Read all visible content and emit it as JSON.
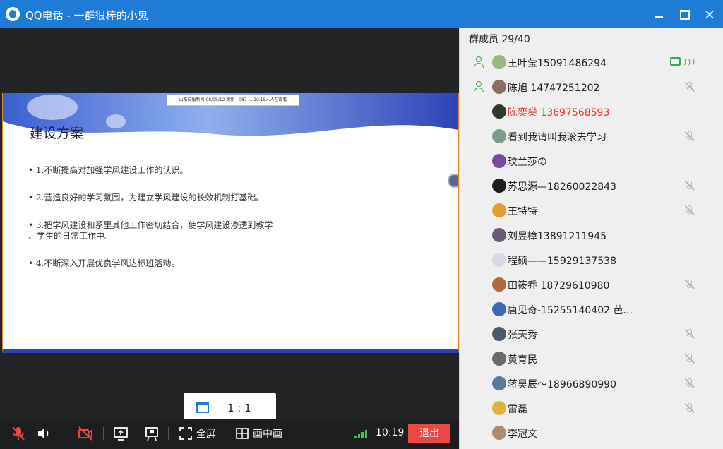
{
  "window": {
    "title": "QQ电话 - 一群很棒的小鬼",
    "min_glyph": "",
    "max_glyph": "",
    "close_glyph": "×"
  },
  "slide": {
    "header_text": "山东日报新闻    08/08/12    更新 : 087 ...  20:15人人在观看",
    "title": "建设方案",
    "bullets": [
      "1.不断提高对加强学风建设工作的认识。",
      "2.营造良好的学习氛围，为建立学风建设的长效机制打基础。",
      "3.把学风建设和系里其他工作密切结合，使学风建设渗透到教学\n、学生的日常工作中。",
      "4.不断深入开展优良学风达标班活动。"
    ]
  },
  "ratio": {
    "label": "1 : 1"
  },
  "controls": {
    "fullscreen": "全屏",
    "pip": "画中画",
    "time": "10:19",
    "exit": "退出"
  },
  "members": {
    "header": "群成员 29/40",
    "list": [
      {
        "name": "王叶莹15091486294",
        "host": true,
        "status": "speaking",
        "red": false,
        "avatar_color": "#9ab87f"
      },
      {
        "name": "陈旭  14747251202",
        "host": true,
        "status": "muted",
        "red": false,
        "avatar_color": "#8a7060"
      },
      {
        "name": "陈奕燊 13697568593",
        "host": false,
        "status": "none",
        "red": true,
        "avatar_color": "#2f3a2f"
      },
      {
        "name": "看到我请叫我滚去学习",
        "host": false,
        "status": "muted",
        "red": false,
        "avatar_color": "#7e9b8c"
      },
      {
        "name": "玟兰莎の",
        "host": false,
        "status": "none",
        "red": false,
        "avatar_color": "#7a4a9a"
      },
      {
        "name": "苏思源—18260022843",
        "host": false,
        "status": "muted",
        "red": false,
        "avatar_color": "#1d1d1d"
      },
      {
        "name": "王特特",
        "host": false,
        "status": "muted",
        "red": false,
        "avatar_color": "#e0a030"
      },
      {
        "name": "刘昱樟13891211945",
        "host": false,
        "status": "none",
        "red": false,
        "avatar_color": "#6a5a7a"
      },
      {
        "name": "程硕——15929137538",
        "host": false,
        "status": "none",
        "red": false,
        "avatar_color": "#d8d8e8"
      },
      {
        "name": "田筱乔 18729610980",
        "host": false,
        "status": "muted",
        "red": false,
        "avatar_color": "#b06a40"
      },
      {
        "name": "唐见奇-15255140402 芭...",
        "host": false,
        "status": "none",
        "red": false,
        "avatar_color": "#3a6ab0"
      },
      {
        "name": "张天秀",
        "host": false,
        "status": "muted",
        "red": false,
        "avatar_color": "#4a5a6a"
      },
      {
        "name": "黄育民",
        "host": false,
        "status": "muted",
        "red": false,
        "avatar_color": "#6a6a6a"
      },
      {
        "name": "蒋昊辰～18966890990",
        "host": false,
        "status": "muted",
        "red": false,
        "avatar_color": "#5a7aa0"
      },
      {
        "name": "雷磊",
        "host": false,
        "status": "muted",
        "red": false,
        "avatar_color": "#e0b040"
      },
      {
        "name": "李冠文",
        "host": false,
        "status": "none",
        "red": false,
        "avatar_color": "#b08a6a"
      }
    ]
  }
}
